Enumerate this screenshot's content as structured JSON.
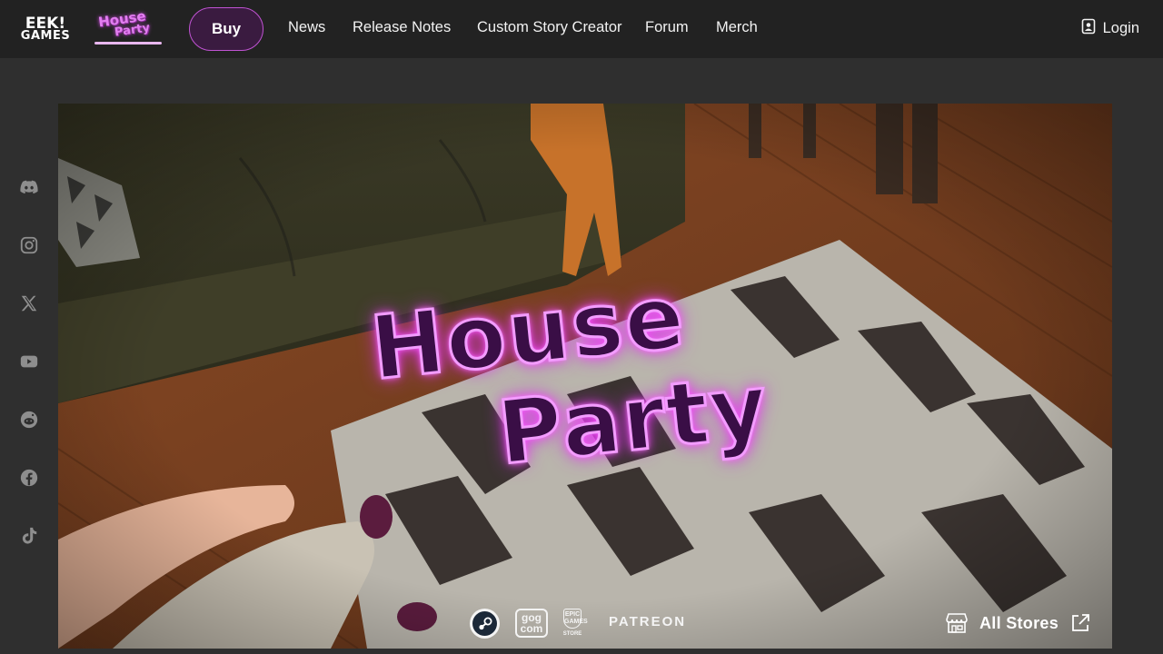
{
  "brand": {
    "studio_logo_line1": "EEK!",
    "studio_logo_line2": "GAMES",
    "game_logo_line1": "House",
    "game_logo_line2": "Party"
  },
  "nav": {
    "buy_label": "Buy",
    "links": [
      "News",
      "Release Notes",
      "Custom Story Creator",
      "Forum",
      "Merch"
    ],
    "login_label": "Login"
  },
  "social": [
    "discord-icon",
    "instagram-icon",
    "x-icon",
    "youtube-icon",
    "reddit-icon",
    "facebook-icon",
    "tiktok-icon"
  ],
  "hero": {
    "title_line1": "House",
    "title_line2": "Party",
    "stores": {
      "gog_line1": "gog",
      "gog_line2": "com",
      "epic_line1": "EPIC",
      "epic_line2": "GAMES",
      "epic_line3": "STORE",
      "patreon": "PATREON",
      "all_stores_label": "All Stores"
    }
  },
  "colors": {
    "topbar": "#222222",
    "page_bg": "#2f2f2f",
    "accent": "#c053d3",
    "neon_pink": "#f39cff"
  }
}
